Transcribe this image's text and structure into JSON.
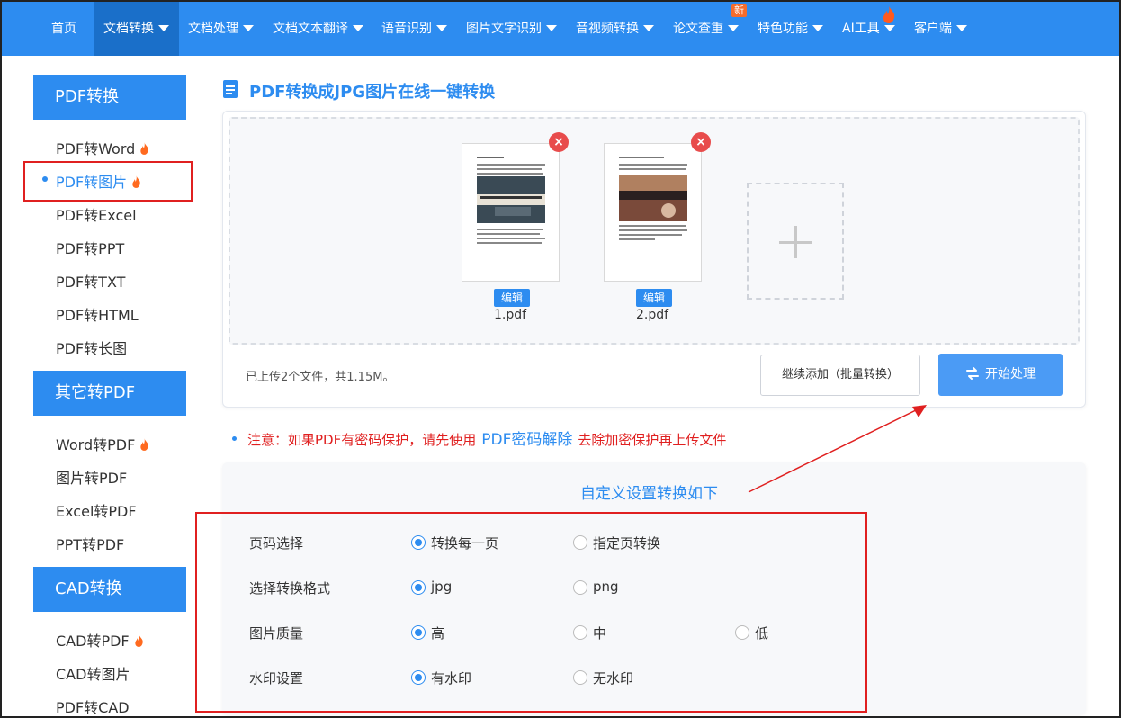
{
  "nav": {
    "items": [
      {
        "label": "首页",
        "caret": false
      },
      {
        "label": "文档转换",
        "caret": true
      },
      {
        "label": "文档处理",
        "caret": true
      },
      {
        "label": "文档文本翻译",
        "caret": true
      },
      {
        "label": "语音识别",
        "caret": true
      },
      {
        "label": "图片文字识别",
        "caret": true
      },
      {
        "label": "音视频转换",
        "caret": true
      },
      {
        "label": "论文查重",
        "caret": true
      },
      {
        "label": "特色功能",
        "caret": true
      },
      {
        "label": "AI工具",
        "caret": true
      },
      {
        "label": "客户端",
        "caret": true
      }
    ],
    "active_index": 1,
    "new_badge": "新"
  },
  "sidebar": {
    "sections": [
      {
        "title": "PDF转换",
        "items": [
          "PDF转Word",
          "PDF转图片",
          "PDF转Excel",
          "PDF转PPT",
          "PDF转TXT",
          "PDF转HTML",
          "PDF转长图"
        ]
      },
      {
        "title": "其它转PDF",
        "items": [
          "Word转PDF",
          "图片转PDF",
          "Excel转PDF",
          "PPT转PDF"
        ]
      },
      {
        "title": "CAD转换",
        "items": [
          "CAD转PDF",
          "CAD转图片",
          "PDF转CAD"
        ]
      }
    ],
    "current_item": "PDF转图片",
    "hot_items": [
      "PDF转Word",
      "PDF转图片",
      "Word转PDF",
      "CAD转PDF"
    ]
  },
  "main": {
    "title": "PDF转换成JPG图片在线一键转换",
    "files": [
      {
        "name": "1.pdf",
        "edit_label": "编辑"
      },
      {
        "name": "2.pdf",
        "edit_label": "编辑"
      }
    ],
    "status": "已上传2个文件，共1.15M。",
    "continue_button": "继续添加（批量转换）",
    "start_button": "开始处理",
    "note_prefix": "注意：如果PDF有密码保护，请先使用",
    "note_link": "PDF密码解除",
    "note_suffix": "去除加密保护再上传文件"
  },
  "settings": {
    "title": "自定义设置转换如下",
    "rows": [
      {
        "label": "页码选择",
        "options": [
          "转换每一页",
          "指定页转换"
        ],
        "selected": 0
      },
      {
        "label": "选择转换格式",
        "options": [
          "jpg",
          "png"
        ],
        "selected": 0
      },
      {
        "label": "图片质量",
        "options": [
          "高",
          "中",
          "低"
        ],
        "selected": 0
      },
      {
        "label": "水印设置",
        "options": [
          "有水印",
          "无水印"
        ],
        "selected": 0
      }
    ]
  },
  "colors": {
    "brand": "#2d8cf0",
    "nav_active": "#1a6fc9",
    "highlight": "#e02020",
    "close": "#e84c4c",
    "start_button": "#4b9bf5"
  },
  "icons": [
    "chevron-down-icon",
    "fire-icon",
    "document-icon",
    "close-icon",
    "plus-icon",
    "convert-icon"
  ]
}
